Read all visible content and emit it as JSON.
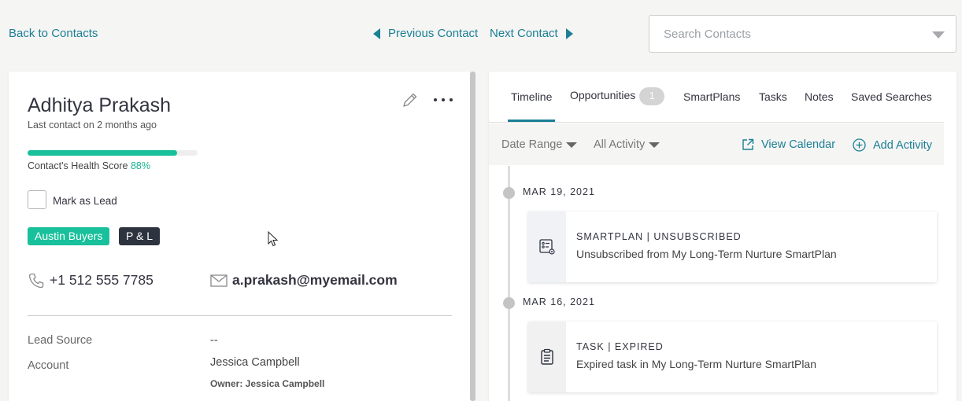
{
  "nav": {
    "back": "Back to Contacts",
    "previous": "Previous Contact",
    "next": "Next Contact",
    "search_placeholder": "Search Contacts"
  },
  "contact": {
    "name": "Adhitya Prakash",
    "last_contact": "Last contact on 2 months ago",
    "health_label": "Contact's Health Score",
    "health_score": "88%",
    "health_fraction": 0.88,
    "mark_as_lead": "Mark as Lead",
    "tags": [
      "Austin Buyers",
      "P & L"
    ],
    "phone": "+1 512 555 7785",
    "email": "a.prakash@myemail.com",
    "fields": [
      {
        "label": "Lead Source",
        "value": "--"
      },
      {
        "label": "Account",
        "value": "Jessica Campbell"
      }
    ],
    "owner": "Owner: Jessica Campbell"
  },
  "tabs": [
    {
      "label": "Timeline",
      "active": true
    },
    {
      "label": "Opportunities",
      "badge": "1"
    },
    {
      "label": "SmartPlans"
    },
    {
      "label": "Tasks"
    },
    {
      "label": "Notes"
    },
    {
      "label": "Saved Searches"
    }
  ],
  "filters": {
    "date_range": "Date Range",
    "activity": "All Activity",
    "view_calendar": "View Calendar",
    "add_activity": "Add Activity"
  },
  "timeline": [
    {
      "date": "MAR 19, 2021",
      "title": "SMARTPLAN | UNSUBSCRIBED",
      "description": "Unsubscribed from My Long-Term Nurture SmartPlan",
      "icon": "smartplan-icon"
    },
    {
      "date": "MAR 16, 2021",
      "title": "TASK | EXPIRED",
      "description": "Expired task in My Long-Term Nurture SmartPlan",
      "icon": "clipboard-icon"
    }
  ],
  "colors": {
    "accent": "#1b7f95",
    "health": "#18c09b",
    "tag_green": "#18c09b",
    "tag_dark": "#2e3340"
  }
}
